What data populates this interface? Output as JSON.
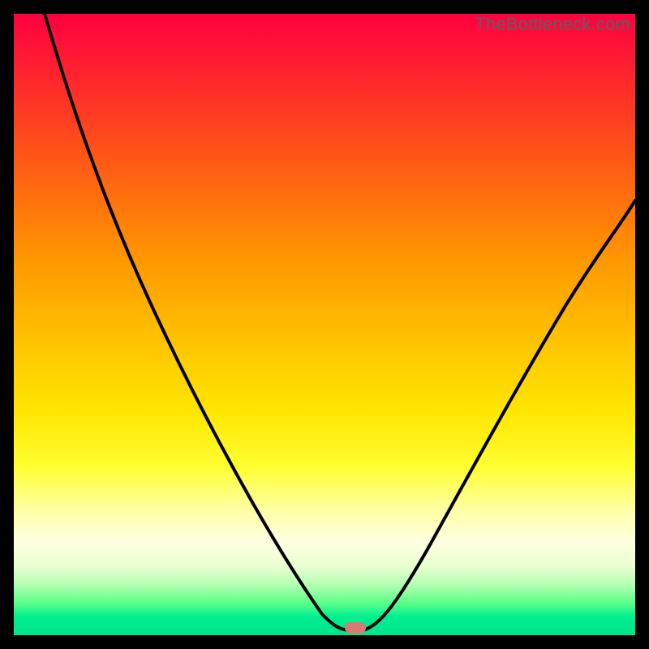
{
  "watermark": "TheBottleneck.com",
  "colors": {
    "frame": "#000000",
    "curve": "#000000",
    "marker": "#d97a72"
  },
  "chart_data": {
    "type": "line",
    "title": "",
    "xlabel": "",
    "ylabel": "",
    "xlim": [
      0,
      100
    ],
    "ylim": [
      0,
      100
    ],
    "background_gradient": {
      "top_color": "#ff0040",
      "middle_color": "#ffe600",
      "bottom_color": "#00e68c",
      "meaning": "red high bottleneck, green low bottleneck"
    },
    "series": [
      {
        "name": "left-branch",
        "x": [
          5,
          10,
          15,
          20,
          25,
          30,
          35,
          40,
          45,
          50,
          52,
          54
        ],
        "values": [
          100,
          87,
          75,
          64,
          53,
          43,
          33,
          23,
          13,
          4,
          1,
          0
        ]
      },
      {
        "name": "right-branch",
        "x": [
          56,
          58,
          60,
          65,
          70,
          75,
          80,
          85,
          90,
          95,
          100
        ],
        "values": [
          0,
          3,
          7,
          17,
          26,
          35,
          43,
          51,
          58,
          64,
          70
        ]
      }
    ],
    "optimal_point": {
      "x": 55,
      "y": 0
    },
    "marker": {
      "x": 55,
      "y": 0,
      "color": "#d97a72"
    }
  }
}
